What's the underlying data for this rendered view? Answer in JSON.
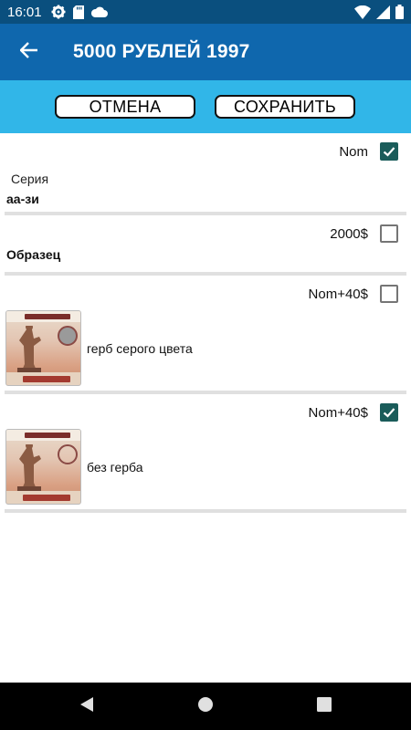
{
  "status_bar": {
    "time": "16:01",
    "icons_left": [
      "gear-icon",
      "sd-card-icon",
      "cloud-icon"
    ],
    "icons_right": [
      "wifi-icon",
      "signal-icon",
      "battery-icon"
    ]
  },
  "app_bar": {
    "title": "5000 РУБЛЕЙ 1997",
    "back_icon": "arrow-back-icon"
  },
  "actions": {
    "cancel_label": "ОТМЕНА",
    "save_label": "СОХРАНИТЬ"
  },
  "items": [
    {
      "price": "Nom",
      "checked": true,
      "series_label": "Серия",
      "series_value": "аа-зи"
    },
    {
      "price": "2000$",
      "checked": false,
      "label": "Образец"
    },
    {
      "price": "Nom+40$",
      "checked": false,
      "caption": "герб серого цвета",
      "thumb_icon": "banknote-grey-emblem-thumbnail"
    },
    {
      "price": "Nom+40$",
      "checked": true,
      "caption": "без герба",
      "thumb_icon": "banknote-no-emblem-thumbnail"
    }
  ],
  "colors": {
    "status_bar": "#0a4f7e",
    "app_bar": "#0f67ad",
    "action_band": "#31b6e8",
    "checkbox_checked": "#1a5c5a",
    "divider": "#e0e0e0"
  },
  "nav_bar": {
    "buttons": [
      "back-triangle-icon",
      "home-circle-icon",
      "recents-square-icon"
    ]
  }
}
